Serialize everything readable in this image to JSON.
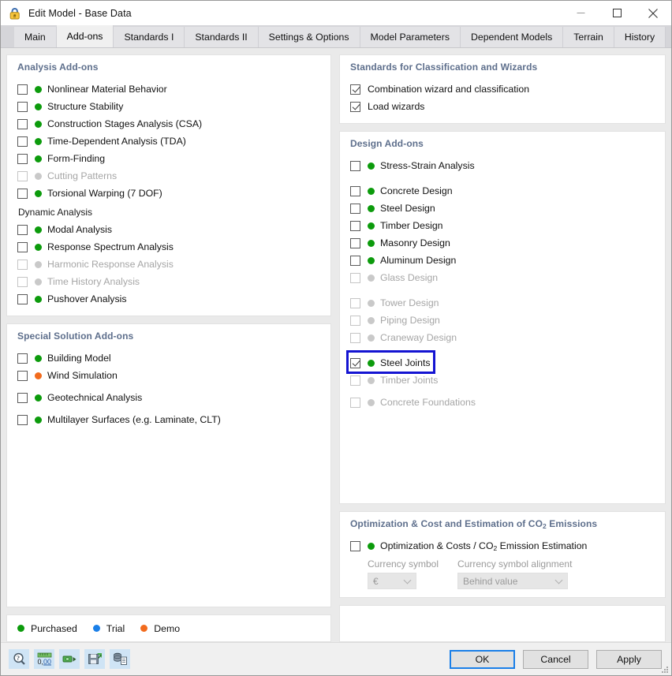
{
  "window": {
    "title": "Edit Model - Base Data",
    "icon": "lock-model-icon",
    "minimize": "—",
    "maximize": "□",
    "close": "✕"
  },
  "tabs": [
    {
      "label": "Main",
      "active": false
    },
    {
      "label": "Add-ons",
      "active": true
    },
    {
      "label": "Standards I",
      "active": false
    },
    {
      "label": "Standards II",
      "active": false
    },
    {
      "label": "Settings & Options",
      "active": false
    },
    {
      "label": "Model Parameters",
      "active": false
    },
    {
      "label": "Dependent Models",
      "active": false
    },
    {
      "label": "Terrain",
      "active": false
    },
    {
      "label": "History",
      "active": false
    }
  ],
  "left": {
    "analysis": {
      "title": "Analysis Add-ons",
      "items": [
        {
          "label": "Nonlinear Material Behavior",
          "checked": false,
          "status": "green",
          "disabled": false
        },
        {
          "label": "Structure Stability",
          "checked": false,
          "status": "green",
          "disabled": false
        },
        {
          "label": "Construction Stages Analysis (CSA)",
          "checked": false,
          "status": "green",
          "disabled": false
        },
        {
          "label": "Time-Dependent Analysis (TDA)",
          "checked": false,
          "status": "green",
          "disabled": false
        },
        {
          "label": "Form-Finding",
          "checked": false,
          "status": "green",
          "disabled": false
        },
        {
          "label": "Cutting Patterns",
          "checked": false,
          "status": "gray",
          "disabled": true
        },
        {
          "label": "Torsional Warping (7 DOF)",
          "checked": false,
          "status": "green",
          "disabled": false
        }
      ],
      "dynamic_title": "Dynamic Analysis",
      "dynamic_items": [
        {
          "label": "Modal Analysis",
          "checked": false,
          "status": "green",
          "disabled": false
        },
        {
          "label": "Response Spectrum Analysis",
          "checked": false,
          "status": "green",
          "disabled": false
        },
        {
          "label": "Harmonic Response Analysis",
          "checked": false,
          "status": "gray",
          "disabled": true
        },
        {
          "label": "Time History Analysis",
          "checked": false,
          "status": "gray",
          "disabled": true
        },
        {
          "label": "Pushover Analysis",
          "checked": false,
          "status": "green",
          "disabled": false
        }
      ]
    },
    "special": {
      "title": "Special Solution Add-ons",
      "items": [
        {
          "label": "Building Model",
          "checked": false,
          "status": "green",
          "disabled": false
        },
        {
          "label": "Wind Simulation",
          "checked": false,
          "status": "orange",
          "disabled": false
        },
        {
          "label": "Geotechnical Analysis",
          "checked": false,
          "status": "green",
          "disabled": false
        },
        {
          "label": "Multilayer Surfaces (e.g. Laminate, CLT)",
          "checked": false,
          "status": "green",
          "disabled": false
        }
      ]
    },
    "legend": {
      "items": [
        {
          "label": "Purchased",
          "status": "green"
        },
        {
          "label": "Trial",
          "status": "blue"
        },
        {
          "label": "Demo",
          "status": "orange"
        }
      ]
    }
  },
  "right": {
    "standards": {
      "title": "Standards for Classification and Wizards",
      "items": [
        {
          "label": "Combination wizard and classification",
          "checked": true,
          "status": "none",
          "disabled": false
        },
        {
          "label": "Load wizards",
          "checked": true,
          "status": "none",
          "disabled": false
        }
      ]
    },
    "design": {
      "title": "Design Add-ons",
      "items": [
        {
          "label": "Stress-Strain Analysis",
          "checked": false,
          "status": "green",
          "disabled": false
        },
        {
          "label": "Concrete Design",
          "checked": false,
          "status": "green",
          "disabled": false
        },
        {
          "label": "Steel Design",
          "checked": false,
          "status": "green",
          "disabled": false
        },
        {
          "label": "Timber Design",
          "checked": false,
          "status": "green",
          "disabled": false
        },
        {
          "label": "Masonry Design",
          "checked": false,
          "status": "green",
          "disabled": false
        },
        {
          "label": "Aluminum Design",
          "checked": false,
          "status": "green",
          "disabled": false
        },
        {
          "label": "Glass Design",
          "checked": false,
          "status": "gray",
          "disabled": true
        },
        {
          "label": "Tower Design",
          "checked": false,
          "status": "gray",
          "disabled": true
        },
        {
          "label": "Piping Design",
          "checked": false,
          "status": "gray",
          "disabled": true
        },
        {
          "label": "Craneway Design",
          "checked": false,
          "status": "gray",
          "disabled": true
        },
        {
          "label": "Steel Joints",
          "checked": true,
          "status": "green",
          "disabled": false,
          "highlighted": true
        },
        {
          "label": "Timber Joints",
          "checked": false,
          "status": "gray",
          "disabled": true
        },
        {
          "label": "Concrete Foundations",
          "checked": false,
          "status": "gray",
          "disabled": true
        }
      ]
    },
    "optimization": {
      "title_part1": "Optimization & Cost and Estimation of CO",
      "title_sub": "2",
      "title_part2": " Emissions",
      "option_part1": "Optimization & Costs / CO",
      "option_sub": "2",
      "option_part2": " Emission Estimation",
      "option_checked": false,
      "option_status": "green",
      "currency_symbol_label": "Currency symbol",
      "currency_symbol_value": "€",
      "currency_alignment_label": "Currency symbol alignment",
      "currency_alignment_value": "Behind value"
    }
  },
  "footer": {
    "tools": [
      {
        "name": "help-search-icon"
      },
      {
        "name": "units-icon"
      },
      {
        "name": "export-icon"
      },
      {
        "name": "save-settings-icon"
      },
      {
        "name": "database-report-icon"
      }
    ],
    "buttons": [
      {
        "label": "OK",
        "primary": true
      },
      {
        "label": "Cancel",
        "primary": false
      },
      {
        "label": "Apply",
        "primary": false
      }
    ]
  }
}
